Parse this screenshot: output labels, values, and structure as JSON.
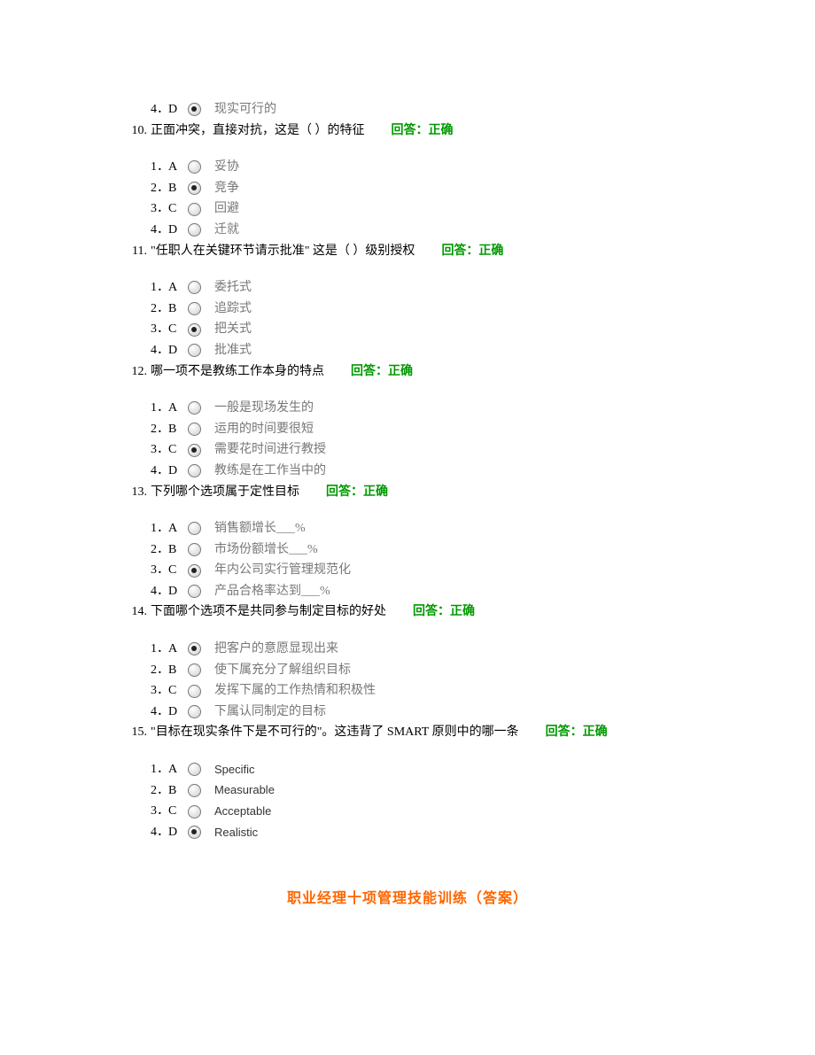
{
  "top_option": {
    "num": "4．",
    "letter": "D",
    "text": "现实可行的",
    "checked": true
  },
  "questions": [
    {
      "num": "10.",
      "text": "正面冲突，直接对抗，这是（ ）的特征",
      "answer_label": "回答：正确",
      "options": [
        {
          "num": "1．",
          "letter": "A",
          "text": "妥协",
          "checked": false
        },
        {
          "num": "2．",
          "letter": "B",
          "text": "竞争",
          "checked": true
        },
        {
          "num": "3．",
          "letter": "C",
          "text": "回避",
          "checked": false
        },
        {
          "num": "4．",
          "letter": "D",
          "text": "迁就",
          "checked": false
        }
      ]
    },
    {
      "num": "11.",
      "text": "\"任职人在关键环节请示批准\"  这是（ ）级别授权",
      "answer_label": "回答：正确",
      "options": [
        {
          "num": "1．",
          "letter": "A",
          "text": "委托式",
          "checked": false
        },
        {
          "num": "2．",
          "letter": "B",
          "text": "追踪式",
          "checked": false
        },
        {
          "num": "3．",
          "letter": "C",
          "text": "把关式",
          "checked": true
        },
        {
          "num": "4．",
          "letter": "D",
          "text": "批准式",
          "checked": false
        }
      ]
    },
    {
      "num": "12.",
      "text": "哪一项不是教练工作本身的特点",
      "answer_label": "回答：正确",
      "options": [
        {
          "num": "1．",
          "letter": "A",
          "text": "一般是现场发生的",
          "checked": false
        },
        {
          "num": "2．",
          "letter": "B",
          "text": "运用的时间要很短",
          "checked": false
        },
        {
          "num": "3．",
          "letter": "C",
          "text": "需要花时间进行教授",
          "checked": true
        },
        {
          "num": "4．",
          "letter": "D",
          "text": "教练是在工作当中的",
          "checked": false
        }
      ]
    },
    {
      "num": "13.",
      "text": "下列哪个选项属于定性目标",
      "answer_label": "回答：正确",
      "options": [
        {
          "num": "1．",
          "letter": "A",
          "text": "销售额增长___%",
          "checked": false
        },
        {
          "num": "2．",
          "letter": "B",
          "text": "市场份额增长___%",
          "checked": false
        },
        {
          "num": "3．",
          "letter": "C",
          "text": "年内公司实行管理规范化",
          "checked": true
        },
        {
          "num": "4．",
          "letter": "D",
          "text": "产品合格率达到___%",
          "checked": false
        }
      ]
    },
    {
      "num": "14.",
      "text": "下面哪个选项不是共同参与制定目标的好处",
      "answer_label": "回答：正确",
      "options": [
        {
          "num": "1．",
          "letter": "A",
          "text": "把客户的意愿显现出来",
          "checked": true
        },
        {
          "num": "2．",
          "letter": "B",
          "text": "使下属充分了解组织目标",
          "checked": false
        },
        {
          "num": "3．",
          "letter": "C",
          "text": "发挥下属的工作热情和积极性",
          "checked": false
        },
        {
          "num": "4．",
          "letter": "D",
          "text": "下属认同制定的目标",
          "checked": false
        }
      ]
    },
    {
      "num": "15.",
      "text": "\"目标在现实条件下是不可行的\"。这违背了 SMART 原则中的哪一条",
      "answer_label": "回答：正确",
      "english": true,
      "options": [
        {
          "num": "1．",
          "letter": "A",
          "text": "Specific",
          "checked": false
        },
        {
          "num": "2．",
          "letter": "B",
          "text": "Measurable",
          "checked": false
        },
        {
          "num": "3．",
          "letter": "C",
          "text": "Acceptable",
          "checked": false
        },
        {
          "num": "4．",
          "letter": "D",
          "text": "Realistic",
          "checked": true
        }
      ]
    }
  ],
  "footer_title": "职业经理十项管理技能训练（答案）"
}
